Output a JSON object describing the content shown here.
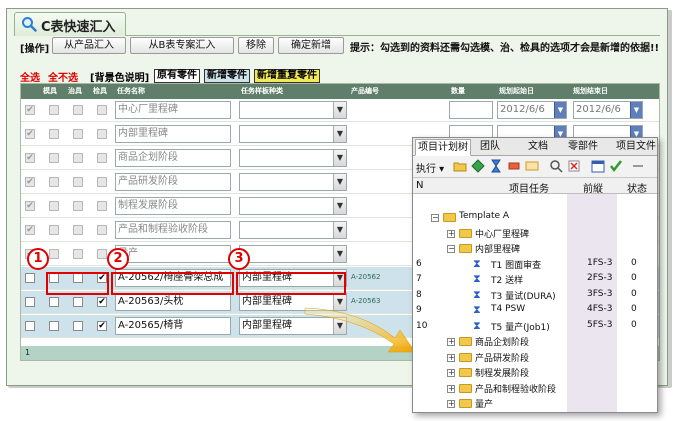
{
  "window": {
    "title": "C表快速汇入",
    "toolbar": {
      "op_label": "[操作]",
      "buttons": [
        "从产品汇入",
        "从B表专案汇入",
        "移除",
        "确定新增"
      ],
      "hint": "提示：勾选到的资料还需勾选模、治、检具的选项才会是新增的依据!!"
    },
    "legend": {
      "select_all": "全选",
      "deselect_all": "全不选",
      "bg_desc": "[背景色说明]",
      "existing": "原有零件",
      "new": "新增零件",
      "new_dup": "新增重复零件",
      "colors": {
        "existing": "#ffffff",
        "new": "#cde2ea",
        "new_dup": "#f1e85a"
      }
    },
    "grid": {
      "headers": [
        "模具",
        "治具",
        "检具",
        "任务名称",
        "任务样板种类",
        "产品编号",
        "数量",
        "规划起始日",
        "规划结束日"
      ],
      "rows": [
        {
          "task": "中心厂里程碑",
          "type": "",
          "code": "",
          "start": "2012/6/6",
          "end": "2012/6/6",
          "cb": [
            true,
            false,
            false,
            false
          ],
          "disabled": true,
          "highlight": false
        },
        {
          "task": "内部里程碑",
          "type": "",
          "code": "",
          "start": "",
          "end": "",
          "cb": [
            true,
            false,
            false,
            false
          ],
          "disabled": true,
          "highlight": false
        },
        {
          "task": "商品企划阶段",
          "type": "",
          "code": "",
          "start": "",
          "end": "",
          "cb": [
            true,
            false,
            false,
            false
          ],
          "disabled": true,
          "highlight": false
        },
        {
          "task": "产品研发阶段",
          "type": "",
          "code": "",
          "start": "",
          "end": "",
          "cb": [
            true,
            false,
            false,
            false
          ],
          "disabled": true,
          "highlight": false
        },
        {
          "task": "制程发展阶段",
          "type": "",
          "code": "",
          "start": "",
          "end": "",
          "cb": [
            true,
            false,
            false,
            false
          ],
          "disabled": true,
          "highlight": false
        },
        {
          "task": "产品和制程验收阶段",
          "type": "",
          "code": "",
          "start": "",
          "end": "",
          "cb": [
            true,
            false,
            false,
            false
          ],
          "disabled": true,
          "highlight": false
        },
        {
          "task": "量产",
          "type": "",
          "code": "",
          "start": "",
          "end": "",
          "cb": [
            true,
            false,
            false,
            false
          ],
          "disabled": true,
          "highlight": false
        },
        {
          "task": "A-20562/椅座骨架总成",
          "type": "内部里程碑",
          "code": "A-20562",
          "start": "",
          "end": "",
          "cb": [
            false,
            false,
            false,
            true
          ],
          "disabled": false,
          "highlight": true
        },
        {
          "task": "A-20563/头枕",
          "type": "内部里程碑",
          "code": "A-20563",
          "start": "",
          "end": "",
          "cb": [
            false,
            false,
            false,
            true
          ],
          "disabled": false,
          "highlight": true
        },
        {
          "task": "A-20565/椅背",
          "type": "内部里程碑",
          "code": "",
          "start": "",
          "end": "",
          "cb": [
            false,
            false,
            false,
            true
          ],
          "disabled": false,
          "highlight": true
        }
      ],
      "pager": "1"
    }
  },
  "callouts": [
    "1",
    "2",
    "3"
  ],
  "popup": {
    "tabs": [
      "项目计划树",
      "团队",
      "文档",
      "零部件",
      "项目文件"
    ],
    "execute_label": "执行",
    "columns": {
      "n": "N",
      "task": "项目任务",
      "pred": "前縦",
      "status": "状态"
    },
    "tree": [
      {
        "n": "",
        "label": "Template A",
        "kind": "folder",
        "indent": 0,
        "exp": "−",
        "pred": "",
        "status": ""
      },
      {
        "n": "",
        "label": "中心厂里程碑",
        "kind": "folder",
        "indent": 1,
        "exp": "+",
        "pred": "",
        "status": ""
      },
      {
        "n": "",
        "label": "内部里程碑",
        "kind": "folder",
        "indent": 1,
        "exp": "−",
        "pred": "",
        "status": ""
      },
      {
        "n": "6",
        "label": "T1 图面审查",
        "kind": "task",
        "indent": 2,
        "exp": "",
        "pred": "1FS-3",
        "status": "0"
      },
      {
        "n": "7",
        "label": "T2 送样",
        "kind": "task",
        "indent": 2,
        "exp": "",
        "pred": "2FS-3",
        "status": "0"
      },
      {
        "n": "8",
        "label": "T3 量试(DURA)",
        "kind": "task",
        "indent": 2,
        "exp": "",
        "pred": "3FS-3",
        "status": "0"
      },
      {
        "n": "9",
        "label": "T4 PSW",
        "kind": "task",
        "indent": 2,
        "exp": "",
        "pred": "4FS-3",
        "status": "0"
      },
      {
        "n": "10",
        "label": "T5 量产(Job1)",
        "kind": "task",
        "indent": 2,
        "exp": "",
        "pred": "5FS-3",
        "status": "0"
      },
      {
        "n": "",
        "label": "商品企划阶段",
        "kind": "folder",
        "indent": 1,
        "exp": "+",
        "pred": "",
        "status": ""
      },
      {
        "n": "",
        "label": "产品研发阶段",
        "kind": "folder",
        "indent": 1,
        "exp": "+",
        "pred": "",
        "status": ""
      },
      {
        "n": "",
        "label": "制程发展阶段",
        "kind": "folder",
        "indent": 1,
        "exp": "+",
        "pred": "",
        "status": ""
      },
      {
        "n": "",
        "label": "产品和制程验收阶段",
        "kind": "folder",
        "indent": 1,
        "exp": "+",
        "pred": "",
        "status": ""
      },
      {
        "n": "",
        "label": "量产",
        "kind": "folder",
        "indent": 1,
        "exp": "+",
        "pred": "",
        "status": ""
      }
    ]
  }
}
